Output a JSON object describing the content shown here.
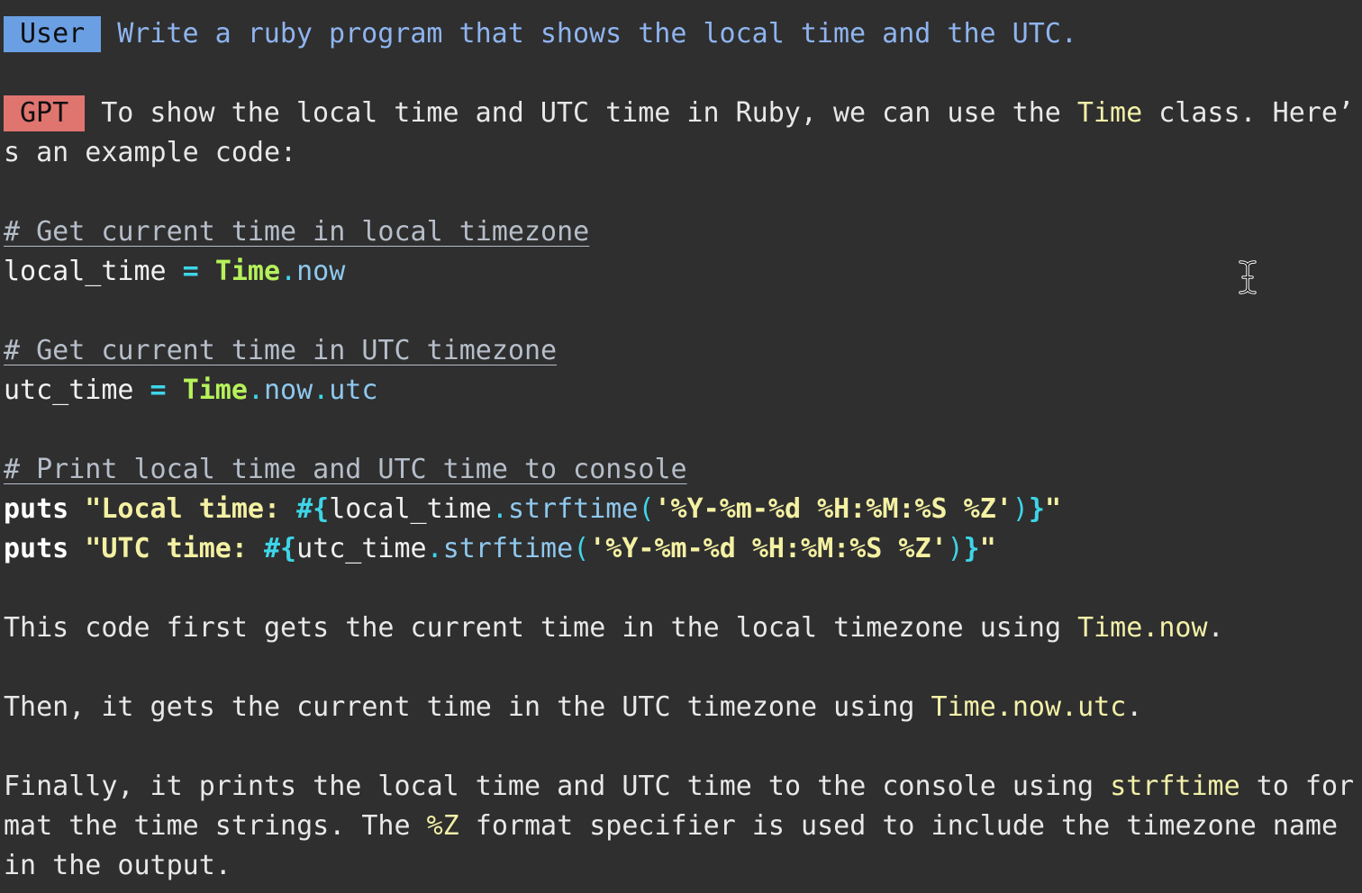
{
  "user": {
    "badge": "User",
    "message": "Write a ruby program that shows the local time and the UTC."
  },
  "gpt": {
    "badge": "GPT",
    "intro_a": "To show the local time and UTC time in Ruby, we can use the ",
    "intro_class": "Time",
    "intro_b": " class. Here’",
    "intro_c": "s an example code:"
  },
  "code": {
    "comment1": "# Get current time in local timezone",
    "line1_var": "local_time",
    "line1_eq": " = ",
    "line1_const": "Time",
    "line1_dot": ".",
    "line1_meth": "now",
    "comment2": "# Get current time in UTC timezone",
    "line2_var": "utc_time",
    "line2_eq": " = ",
    "line2_const": "Time",
    "line2_dot1": ".",
    "line2_meth1": "now",
    "line2_dot2": ".",
    "line2_meth2": "utc",
    "comment3": "# Print local time and UTC time to console",
    "puts1_kw": "puts",
    "puts1_str_a": " \"Local time: ",
    "puts1_interp_open": "#{",
    "puts1_var": "local_time",
    "puts1_dot": ".",
    "puts1_meth": "strftime",
    "puts1_paren_open": "(",
    "puts1_fmt": "'%Y-%m-%d %H:%M:%S %Z'",
    "puts1_paren_close": ")",
    "puts1_interp_close": "}",
    "puts1_str_b": "\"",
    "puts2_kw": "puts",
    "puts2_str_a": " \"UTC time: ",
    "puts2_interp_open": "#{",
    "puts2_var": "utc_time",
    "puts2_dot": ".",
    "puts2_meth": "strftime",
    "puts2_paren_open": "(",
    "puts2_fmt": "'%Y-%m-%d %H:%M:%S %Z'",
    "puts2_paren_close": ")",
    "puts2_interp_close": "}",
    "puts2_str_b": "\""
  },
  "explanation": {
    "p1_a": "This code first gets the current time in the local timezone using ",
    "p1_code": "Time.now",
    "p1_b": ".",
    "p2_a": "Then, it gets the current time in the UTC timezone using ",
    "p2_code": "Time.now.utc",
    "p2_b": ".",
    "p3_a": "Finally, it prints the local time and UTC time to the console using ",
    "p3_code": "strftime",
    "p3_b": " to for",
    "p3_c": "mat the time strings. The ",
    "p3_code2": "%Z",
    "p3_d": " format specifier is used to include the timezone name",
    "p3_e": "in the output."
  },
  "icons": {
    "cursor": "text-cursor-icon"
  },
  "colors": {
    "background": "#2f2f2f",
    "user_badge": "#6a9fe4",
    "gpt_badge": "#e07570",
    "user_text": "#8fb4f0",
    "constant": "#b6f25a",
    "string": "#f4f1a3",
    "operator": "#3ed5e8"
  }
}
